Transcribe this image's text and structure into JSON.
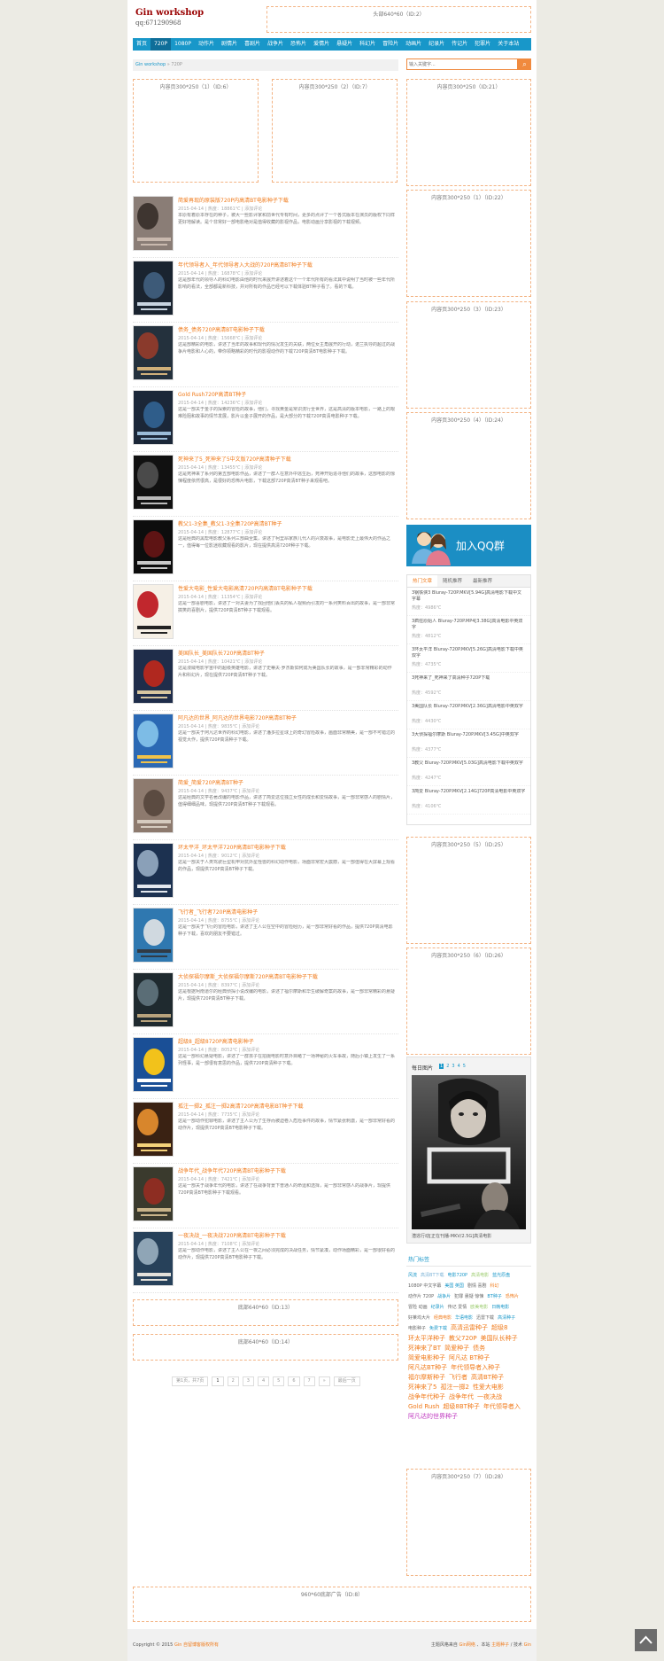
{
  "header": {
    "title": "Gin workshop",
    "subtitle": "qq:671290968",
    "ad_top": "头部640*60（ID:2）"
  },
  "nav": [
    "首页",
    "720P",
    "1080P",
    "动作片",
    "剧情片",
    "喜剧片",
    "战争片",
    "恐怖片",
    "爱情片",
    "悬疑片",
    "科幻片",
    "冒险片",
    "动画片",
    "纪录片",
    "传记片",
    "犯罪片",
    "关于本站"
  ],
  "breadcrumb": {
    "home": "Gin workshop",
    "sep": " » ",
    "current": "720P"
  },
  "search": {
    "placeholder": "输入关键字...",
    "button": "⌕"
  },
  "ads": {
    "content_left": "内容页300*250（1）（ID:6）",
    "content_right": "内容页300*250（2）（ID:7）",
    "side1": "内容页300*250（ID:21）",
    "side2": "内容页300*250（1）（ID:22）",
    "side3": "内容页300*250（3）（ID:23）",
    "side4": "内容页300*250（4）（ID:24）",
    "side5": "内容页300*250（5）（ID:25）",
    "side6": "内容页300*250（6）（ID:26）",
    "side7": "内容页300*250（7）（ID:28）",
    "bottom1": "底部640*60（ID:13）",
    "bottom2": "底部640*60（ID:14）",
    "footer_wide": "960*60底部广告（ID:8）"
  },
  "posts": [
    {
      "title": "简爱再现的原装版720P内高清BT电影种子下载",
      "meta": "2015-04-14 | 热度：18861℃ | 添加评论",
      "excerpt": "本原有着原本存在的种子，被大一些影评家和前世代专有时间，更多的点评了一个各式版本在演员的版权下同样更好地解读。是个非常好一部电影绝对是值得收藏的影视作品，电影动画分享影视的下载视频。"
    },
    {
      "title": "年代领导者入_年代领导者入大战的720P高清BT种子下载",
      "meta": "2015-04-14 | 热度：16878℃ | 添加评论",
      "excerpt": "这是部年代的领导人的科幻电影由他的时代来展开讲述着这个一个年代所有的看法其中说明了当时被一些年代所影响的看法，全部都是新科技，并对所有的作品已经可以下载体验BT种子看了。看的下载。"
    },
    {
      "title": "债务_债务720P高清BT电影种子下载",
      "meta": "2015-04-14 | 热度：15668℃ | 添加评论",
      "excerpt": "这是部精彩的电影，讲述了当年的故事和现代的情况发生的关联，两位女主角展开的行动，诺兰执导的超过的战争片电影和人心的，带你领略精彩的时代的影视动作的下载720P高清BT电影种子下载。"
    },
    {
      "title": "Gold Rush720P高清BT种子",
      "meta": "2015-04-14 | 热度：14236℃ | 添加评论",
      "excerpt": "这是一部关于金子的探索的冒险的故事，他们，寻找黄金是常识流行全世界，这是高清的版本电影，一路上的艰难险阻和故事的情节发展，影片以金子展开的作品，是大部分的下载720P高清电影种子下载。"
    },
    {
      "title": "死神来了5_死神来了5中文版720P高清种子下载",
      "meta": "2015-04-14 | 热度：13455℃ | 添加评论",
      "excerpt": "这是死神来了系列的第五部电影作品，讲述了一群人在意外中逃生后，死神开始追寻他们的故事，这部电影的惊悚程度依然很高，是很好的恐怖片电影，下载这部720P高清BT种子来观看吧。"
    },
    {
      "title": "教父1-3全集_教父1-3全集720P高清BT种子",
      "meta": "2015-04-14 | 热度：12877℃ | 添加评论",
      "excerpt": "这是经典的黑帮电影教父系列三部曲全集，讲述了柯里昂家族几代人的兴衰故事，是电影史上最伟大的作品之一，值得每一位影迷收藏观看的影片，现在提供高清720P种子下载。"
    },
    {
      "title": "性爱大电影_性爱大电影高清720P内高清BT电影种子下载",
      "meta": "2015-04-14 | 热度：11354℃ | 添加评论",
      "excerpt": "这是一部喜剧电影，讲述了一对夫妻为了找回他们丢失的私人视频而引发的一系列笑料百出的故事，是一部非常搞笑的喜剧片，提供720P高清BT种子下载观看。"
    },
    {
      "title": "美国队长_美国队长720P高清BT种子",
      "meta": "2015-04-14 | 热度：10421℃ | 添加评论",
      "excerpt": "这是漫威电影宇宙中的超级英雄电影，讲述了史蒂夫·罗杰斯如何成为美国队长的故事，是一部非常精彩的动作片和科幻片，现在提供720P高清BT种子下载。"
    },
    {
      "title": "阿凡达的世界_阿凡达的世界电影720P高清BT种子",
      "meta": "2015-04-14 | 热度：9835℃ | 添加评论",
      "excerpt": "这是一部关于阿凡达世界的科幻电影，讲述了潘多拉星球上的奇幻冒险故事，画面非常精美，是一部不可错过的视觉大作，提供720P高清种子下载。"
    },
    {
      "title": "简爱_简爱720P高清BT种子",
      "meta": "2015-04-14 | 热度：9437℃ | 添加评论",
      "excerpt": "这是经典的文学名著改编的电影作品，讲述了简爱这位独立女性的成长和爱情故事，是一部非常感人的剧情片，值得细细品味，现提供720P高清BT种子下载观看。"
    },
    {
      "title": "环太平洋_环太平洋720P高清BT电影种子下载",
      "meta": "2015-04-14 | 热度：9012℃ | 添加评论",
      "excerpt": "这是一部关于人类驾驶巨型机甲对抗外星怪兽的科幻动作电影，场面非常宏大震撼，是一部值得在大屏幕上观看的作品，现提供720P高清BT种子下载。"
    },
    {
      "title": "飞行者_飞行者720P高清电影种子",
      "meta": "2015-04-14 | 热度：8755℃ | 添加评论",
      "excerpt": "这是一部关于飞行的冒险电影，讲述了主人公在空中的冒险经历，是一部非常好看的作品，提供720P高清电影种子下载，喜欢的朋友不要错过。"
    },
    {
      "title": "大侦探福尔摩斯_大侦探福尔摩斯720P高清BT电影种子下载",
      "meta": "2015-04-14 | 热度：8397℃ | 添加评论",
      "excerpt": "这是根据柯南道尔的经典侦探小说改编的电影，讲述了福尔摩斯和华生破解奇案的故事，是一部非常精彩的悬疑片，现提供720P高清BT种子下载。"
    },
    {
      "title": "超级8_超级8720P高清电影种子",
      "meta": "2015-04-14 | 热度：8052℃ | 添加评论",
      "excerpt": "这是一部科幻悬疑电影，讲述了一群孩子在拍摄电影时意外目睹了一场神秘的火车事故，随后小镇上发生了一系列怪事，是一部很有意思的作品，提供720P高清种子下载。"
    },
    {
      "title": "孤注一掷2_孤注一掷2高清720P高清电影BT种子下载",
      "meta": "2015-04-14 | 热度：7735℃ | 添加评论",
      "excerpt": "这是一部动作犯罪电影，讲述了主人公为了生存而被迫卷入危险事件的故事，情节紧张刺激，是一部非常好看的动作片，现提供720P高清BT电影种子下载。"
    },
    {
      "title": "战争年代_战争年代720P高清BT电影种子下载",
      "meta": "2015-04-14 | 热度：7421℃ | 添加评论",
      "excerpt": "这是一部关于战争年代的电影，讲述了在战争背景下普通人的命运和选择，是一部非常感人的战争片，现提供720P高清BT电影种子下载观看。"
    },
    {
      "title": "一夜决战_一夜决战720P高清BT电影种子下载",
      "meta": "2015-04-14 | 热度：7108℃ | 添加评论",
      "excerpt": "这是一部动作电影，讲述了主人公在一夜之间必须完成的决战任务，情节紧凑，动作场面精彩，是一部很好看的动作片，现提供720P高清BT电影种子下载。"
    }
  ],
  "pagination": {
    "summary": "第1页，共7页",
    "pages": [
      "1",
      "2",
      "3",
      "4",
      "5",
      "6",
      "7"
    ],
    "next": "»",
    "last": "最后一页"
  },
  "sidebar": {
    "qq_banner": "加入QQ群",
    "tabs": [
      "热门文章",
      "随机推荐",
      "最新推荐"
    ],
    "list": [
      {
        "title": "3钢铁侠3 Bluray-720P.MKV[5.94G]高清电影下载中文字幕",
        "meta": "热度：4986℃"
      },
      {
        "title": "3疯狂原始人 Bluray-720P.MP4[3.38G]高清电影中英双字",
        "meta": "热度：4812℃"
      },
      {
        "title": "3环太平洋 Bluray-720P.MKV[5.26G]高清电影下载中英双字",
        "meta": "热度：4735℃"
      },
      {
        "title": "3死神来了_死神来了高清种子720P下载",
        "meta": "热度：4592℃"
      },
      {
        "title": "3美国队长 Bluray-720P.MKV[2.36G]高清电影中英双字",
        "meta": "热度：4430℃"
      },
      {
        "title": "3大侦探福尔摩斯 Bluray-720P.MKV[3.45G]中英双字",
        "meta": "热度：4377℃"
      },
      {
        "title": "3教父 Bluray-720P.MKV[5.03G]高清电影下载中英双字",
        "meta": "热度：4247℃"
      },
      {
        "title": "3简爱 Bluray-720P.MKV[2.14G]720P高清电影中英双字",
        "meta": "热度：4106℃"
      }
    ],
    "daily_title": "每日图片",
    "daily_pages": [
      "1",
      "2",
      "3",
      "4",
      "5"
    ],
    "daily_caption": "潜逃行动[正在刊播-MKV/2.5G]高清电影",
    "tags_title": "热门标签",
    "tags": [
      {
        "text": "风流",
        "color": "#1897c9",
        "size": 5
      },
      {
        "text": "高清BT下载",
        "color": "#7ab2d6",
        "size": 5
      },
      {
        "text": "电影720P",
        "color": "#1897c9",
        "size": 5
      },
      {
        "text": "高清电影",
        "color": "#9acb6b",
        "size": 5
      },
      {
        "text": "蓝光原盘",
        "color": "#1897c9",
        "size": 5
      },
      {
        "text": "1080P 中文字幕",
        "color": "#666666",
        "size": 5
      },
      {
        "text": "美国 英国",
        "color": "#1897c9",
        "size": 5
      },
      {
        "text": "剧情 喜剧",
        "color": "#666666",
        "size": 5
      },
      {
        "text": "科幻",
        "color": "#f07a1a",
        "size": 5
      },
      {
        "text": "动作片 720P",
        "color": "#666666",
        "size": 5
      },
      {
        "text": "战争片",
        "color": "#1897c9",
        "size": 5
      },
      {
        "text": "犯罪 悬疑 惊悚",
        "color": "#666666",
        "size": 5
      },
      {
        "text": "BT种子",
        "color": "#1897c9",
        "size": 5
      },
      {
        "text": "恐怖片",
        "color": "#f07a1a",
        "size": 5
      },
      {
        "text": "冒险 动画",
        "color": "#666666",
        "size": 5
      },
      {
        "text": "纪录片",
        "color": "#1897c9",
        "size": 5
      },
      {
        "text": "传记 爱情",
        "color": "#666666",
        "size": 5
      },
      {
        "text": "欧美电影",
        "color": "#9acb6b",
        "size": 5
      },
      {
        "text": "日韩电影",
        "color": "#1897c9",
        "size": 5
      },
      {
        "text": "好莱坞大片",
        "color": "#666666",
        "size": 5
      },
      {
        "text": "经典电影",
        "color": "#f07a1a",
        "size": 5
      },
      {
        "text": "华语电影",
        "color": "#1897c9",
        "size": 5
      },
      {
        "text": "迅雷下载",
        "color": "#666666",
        "size": 5
      },
      {
        "text": "高清种子",
        "color": "#1897c9",
        "size": 5
      },
      {
        "text": "电影种子",
        "color": "#666666",
        "size": 5
      },
      {
        "text": "免费下载",
        "color": "#1897c9",
        "size": 5
      },
      {
        "text": "高清迅雷种子",
        "color": "#f07a1a",
        "size": 7
      },
      {
        "text": "超级8",
        "color": "#f07a1a",
        "size": 7
      },
      {
        "text": "环太平洋种子",
        "color": "#f07a1a",
        "size": 7
      },
      {
        "text": "教父720P",
        "color": "#f07a1a",
        "size": 7
      },
      {
        "text": "美国队长种子",
        "color": "#f07a1a",
        "size": 7
      },
      {
        "text": "死神来了BT",
        "color": "#f07a1a",
        "size": 7
      },
      {
        "text": "简爱种子",
        "color": "#f07a1a",
        "size": 7
      },
      {
        "text": "债务",
        "color": "#f07a1a",
        "size": 7
      },
      {
        "text": "简爱电影种子",
        "color": "#f07a1a",
        "size": 7
      },
      {
        "text": "阿凡达 BT种子",
        "color": "#f07a1a",
        "size": 7
      },
      {
        "text": "阿凡达BT种子",
        "color": "#f07a1a",
        "size": 7
      },
      {
        "text": "年代领导者入种子",
        "color": "#f07a1a",
        "size": 7
      },
      {
        "text": "福尔摩斯种子",
        "color": "#f07a1a",
        "size": 7
      },
      {
        "text": "飞行者",
        "color": "#f07a1a",
        "size": 7
      },
      {
        "text": "高清BT种子",
        "color": "#f07a1a",
        "size": 7
      },
      {
        "text": "死神来了5",
        "color": "#f07a1a",
        "size": 7
      },
      {
        "text": "孤注一掷2",
        "color": "#f07a1a",
        "size": 7
      },
      {
        "text": "性爱大电影",
        "color": "#f07a1a",
        "size": 7
      },
      {
        "text": "战争年代种子",
        "color": "#f07a1a",
        "size": 7
      },
      {
        "text": "战争年代",
        "color": "#f07a1a",
        "size": 7
      },
      {
        "text": "一夜决战",
        "color": "#f07a1a",
        "size": 7
      },
      {
        "text": "Gold Rush",
        "color": "#f07a1a",
        "size": 7
      },
      {
        "text": "超级8BT种子",
        "color": "#f07a1a",
        "size": 7
      },
      {
        "text": "年代领导者入",
        "color": "#f07a1a",
        "size": 7
      },
      {
        "text": "阿凡达的世界种子",
        "color": "#c03ac0",
        "size": 7
      }
    ]
  },
  "footer": {
    "copyright": "Copyright © 2015 ",
    "site_link": "Gin 自留博客版权所有",
    "right_text": "主题风格来自 ",
    "right_link1": "Gin网络",
    "right_mid": " 、本站 ",
    "right_link2": "主题种子",
    "right_end": " / 技术 ",
    "right_link3": "Gin"
  },
  "colors": {
    "accent": "#f07a1a",
    "nav": "#1897c9",
    "ad_border": "#f3b383"
  },
  "thumb_palettes": [
    [
      "#8a7d76",
      "#3e3530",
      "#c9b9ae"
    ],
    [
      "#1a2430",
      "#3d5a78",
      "#c8d4e0"
    ],
    [
      "#24313d",
      "#8a3a2c",
      "#d0b07a"
    ],
    [
      "#1b2738",
      "#2f5d8a",
      "#9bbcd8"
    ],
    [
      "#111111",
      "#4a4a4a",
      "#bbbbbb"
    ],
    [
      "#0d0d0d",
      "#5e1414",
      "#c9c9c9"
    ],
    [
      "#f6f0e6",
      "#c1272d",
      "#222222"
    ],
    [
      "#1f2d4a",
      "#b0281f",
      "#d8c7a0"
    ],
    [
      "#2b69b4",
      "#7dbce6",
      "#f0c24a"
    ],
    [
      "#8d7a6e",
      "#5b4b41",
      "#d6cbbf"
    ],
    [
      "#1c3150",
      "#8aa0b8",
      "#e3e8ee"
    ],
    [
      "#2f78b0",
      "#d0d9e0",
      "#303a45"
    ],
    [
      "#1f2a2f",
      "#5a6d76",
      "#b7a27c"
    ],
    [
      "#1a4f96",
      "#f2c21b",
      "#ffffff"
    ],
    [
      "#3a2213",
      "#d8862c",
      "#f4d27a"
    ],
    [
      "#3a3a2d",
      "#8d2d22",
      "#c9b48a"
    ],
    [
      "#27415a",
      "#8fa5b6",
      "#e4e1da"
    ]
  ]
}
